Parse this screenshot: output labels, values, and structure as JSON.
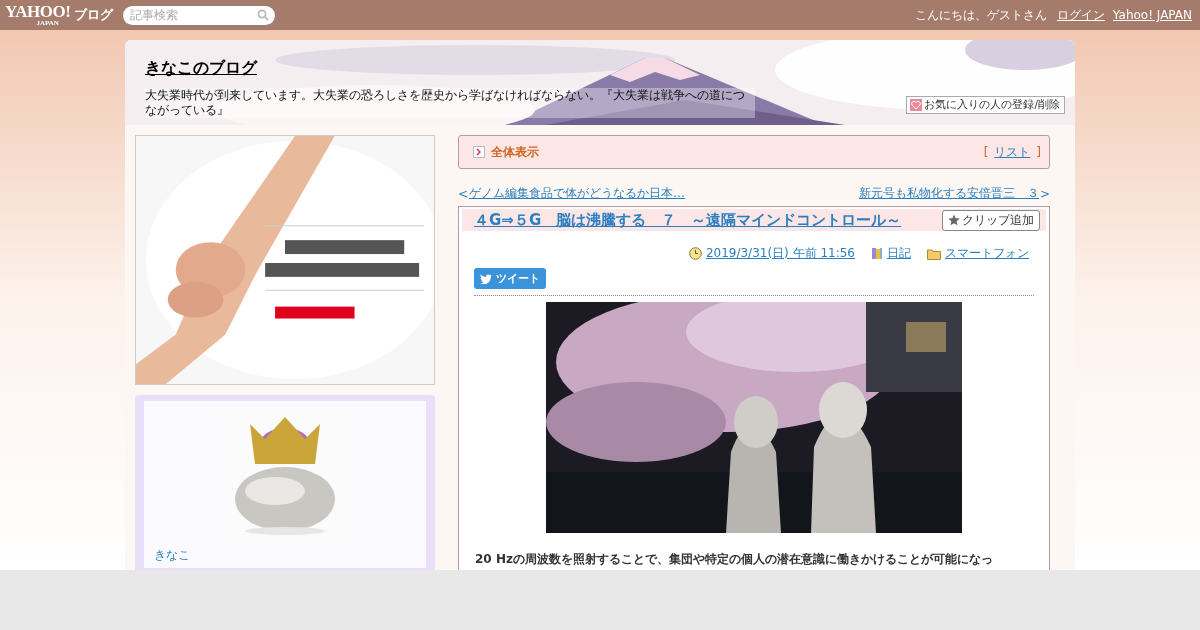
{
  "topbar": {
    "logo": "YAHOO!",
    "logo_sub": "JAPAN",
    "service": "ブログ",
    "search": {
      "placeholder": "記事検索"
    },
    "greeting": "こんにちは、ゲストさん",
    "links": [
      "ログイン",
      "Yahoo! JAPAN"
    ]
  },
  "header": {
    "title": "きなこのブログ",
    "description": "大失業時代が到来しています。大失業の恐ろしさを歴史から学ばなければならない。『大失業は戦争への道につながっている』",
    "favorite_button": "お気に入りの人の登録/削除"
  },
  "sidebar": {
    "profile": {
      "name": "きなこ"
    }
  },
  "view_bar": {
    "label": "全体表示",
    "open_bracket": "[",
    "link": "リスト",
    "close_bracket": "]"
  },
  "nav": {
    "previous_mark": "<",
    "previous": "ゲノム編集食品で体がどうなるか日本…",
    "next": "新元号も私物化する安倍晋三　３",
    "next_mark": ">"
  },
  "article": {
    "title": "４G⇒５G　脳は沸騰する　７　～遠隔マインドコントロール～",
    "clip_button": "クリップ追加",
    "date": "2019/3/31(日) 午前 11:56",
    "category": "日記",
    "folder": "スマートフォン",
    "tweet_button": "ツイート",
    "body": "20 Hzの周波数を照射することで、集団や特定の個人の潜在意識に働きかけることが可能になっ"
  }
}
